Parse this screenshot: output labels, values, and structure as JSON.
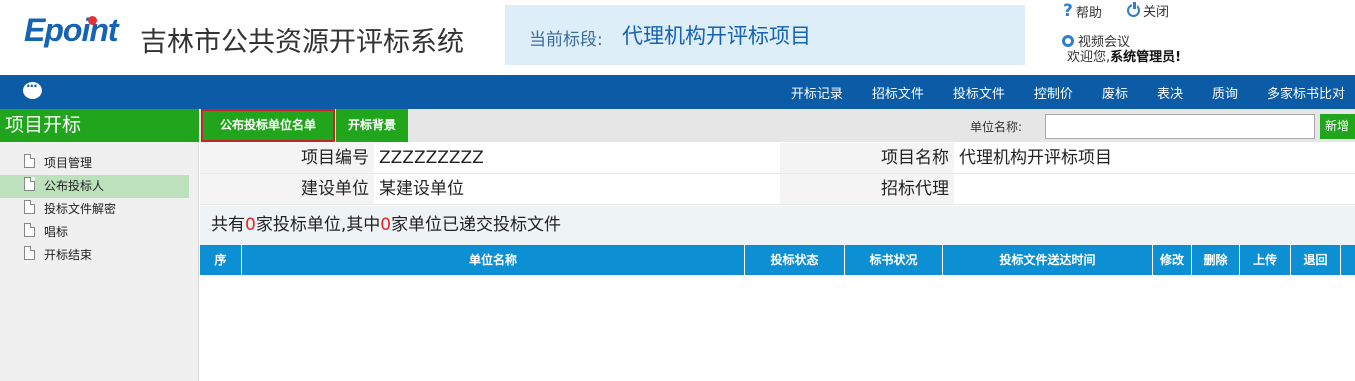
{
  "header": {
    "logo_text": "Epoint",
    "system_title": "吉林市公共资源开评标系统",
    "section_label": "当前标段:",
    "section_value": "代理机构开评标项目",
    "help_label": "帮助",
    "close_label": "关闭",
    "video_label": "视频会议",
    "welcome_prefix": "欢迎您,",
    "welcome_user": "系统管理员!"
  },
  "nav": {
    "items": [
      "开标记录",
      "招标文件",
      "投标文件",
      "控制价",
      "废标",
      "表决",
      "质询",
      "多家标书比对"
    ]
  },
  "sidebar": {
    "title": "项目开标",
    "items": [
      {
        "label": "项目管理",
        "active": false
      },
      {
        "label": "公布投标人",
        "active": true
      },
      {
        "label": "投标文件解密",
        "active": false
      },
      {
        "label": "唱标",
        "active": false
      },
      {
        "label": "开标结束",
        "active": false
      }
    ]
  },
  "toolbar": {
    "publish_label": "公布投标单位名单",
    "background_label": "开标背景",
    "unit_label": "单位名称:",
    "unit_value": "",
    "add_label": "新增"
  },
  "info": {
    "project_code_label": "项目编号",
    "project_code_value": "ZZZZZZZZZ",
    "project_name_label": "项目名称",
    "project_name_value": "代理机构开评标项目",
    "builder_label": "建设单位",
    "builder_value": "某建设单位",
    "agent_label": "招标代理",
    "agent_value": ""
  },
  "summary": {
    "part1": "共有",
    "count1": "0",
    "part2": "家投标单位,其中",
    "count2": "0",
    "part3": "家单位已递交投标文件"
  },
  "grid": {
    "columns": [
      "序",
      "单位名称",
      "投标状态",
      "标书状况",
      "投标文件送达时间",
      "修改",
      "删除",
      "上传",
      "退回"
    ]
  },
  "colors": {
    "primary_blue": "#0c5ba6",
    "green": "#20a51d",
    "grid_header": "#0d8fd4",
    "highlight_red": "#e52525"
  }
}
